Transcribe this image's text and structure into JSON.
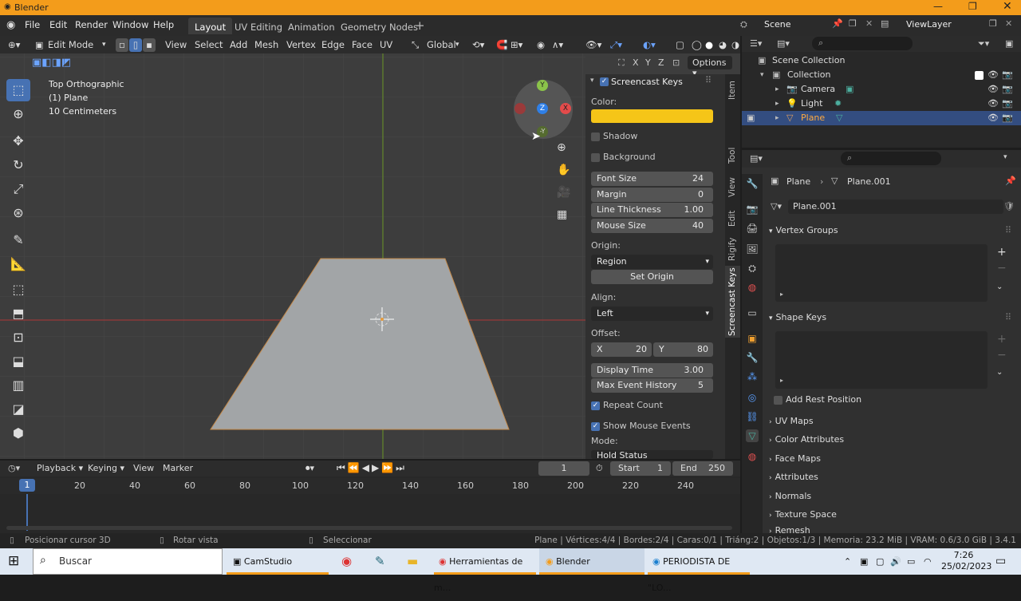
{
  "titlebar": {
    "title": "Blender"
  },
  "menus": [
    "File",
    "Edit",
    "Render",
    "Window",
    "Help"
  ],
  "workspaces": [
    "Layout",
    "UV Editing",
    "Animation",
    "Geometry Nodes"
  ],
  "scene": {
    "name": "Scene",
    "viewlayer": "ViewLayer"
  },
  "viewport": {
    "mode": "Edit Mode",
    "header_menus": [
      "View",
      "Select",
      "Add",
      "Mesh",
      "Vertex",
      "Edge",
      "Face",
      "UV"
    ],
    "transform": "Global",
    "info_lines": [
      "Top Orthographic",
      "(1) Plane",
      "10 Centimeters"
    ],
    "options_label": "Options",
    "axes": [
      "X",
      "Y",
      "Z"
    ],
    "gizmo": {
      "y": "Y",
      "z": "Z",
      "x": "X",
      "ny": "-Y"
    }
  },
  "npanel": {
    "title": "Screencast Keys",
    "color_label": "Color:",
    "color_value": "#f5c518",
    "shadow": "Shadow",
    "background": "Background",
    "fields": [
      {
        "label": "Font Size",
        "value": "24"
      },
      {
        "label": "Margin",
        "value": "0"
      },
      {
        "label": "Line Thickness",
        "value": "1.00"
      },
      {
        "label": "Mouse Size",
        "value": "40"
      }
    ],
    "origin_label": "Origin:",
    "origin_value": "Region",
    "set_origin": "Set Origin",
    "align_label": "Align:",
    "align_value": "Left",
    "offset_label": "Offset:",
    "offset_x_label": "X",
    "offset_x": "20",
    "offset_y_label": "Y",
    "offset_y": "80",
    "display_time_label": "Display Time",
    "display_time": "3.00",
    "max_history_label": "Max Event History",
    "max_history": "5",
    "repeat_count": "Repeat Count",
    "show_mouse": "Show Mouse Events",
    "mode_label": "Mode:",
    "mode_value": "Hold Status"
  },
  "side_tabs": [
    "Item",
    "Tool",
    "View",
    "Edit",
    "Rigify",
    "Screencast Keys"
  ],
  "outliner": {
    "root": "Scene Collection",
    "collection": "Collection",
    "items": [
      "Camera",
      "Light",
      "Plane"
    ]
  },
  "properties": {
    "breadcrumb_object": "Plane",
    "breadcrumb_data": "Plane.001",
    "datablock": "Plane.001",
    "panels": [
      "Vertex Groups",
      "Shape Keys"
    ],
    "add_rest_position": "Add Rest Position",
    "collapsed_panels": [
      "UV Maps",
      "Color Attributes",
      "Face Maps",
      "Attributes",
      "Normals",
      "Texture Space",
      "Remesh"
    ]
  },
  "timeline": {
    "menus": [
      "Playback",
      "Keying",
      "View",
      "Marker"
    ],
    "current_frame": "1",
    "start_label": "Start",
    "start": "1",
    "end_label": "End",
    "end": "250",
    "ticks": [
      "1",
      "20",
      "40",
      "60",
      "80",
      "100",
      "120",
      "140",
      "160",
      "180",
      "200",
      "220",
      "240"
    ]
  },
  "statusbar": {
    "left": [
      "Posicionar cursor 3D",
      "Rotar vista",
      "Seleccionar"
    ],
    "stats": "Plane | Vértices:4/4 | Bordes:2/4 | Caras:0/1 | Triáng:2 | Objetos:1/3 | Memoria: 23.2 MiB | VRAM: 0.6/3.0 GiB | 3.4.1"
  },
  "taskbar": {
    "search": "Buscar",
    "apps": [
      "CamStudio",
      "Herramientas de m...",
      "Blender",
      "PERIODISTA DE \"LO..."
    ],
    "time": "7:26",
    "date": "25/02/2023"
  }
}
